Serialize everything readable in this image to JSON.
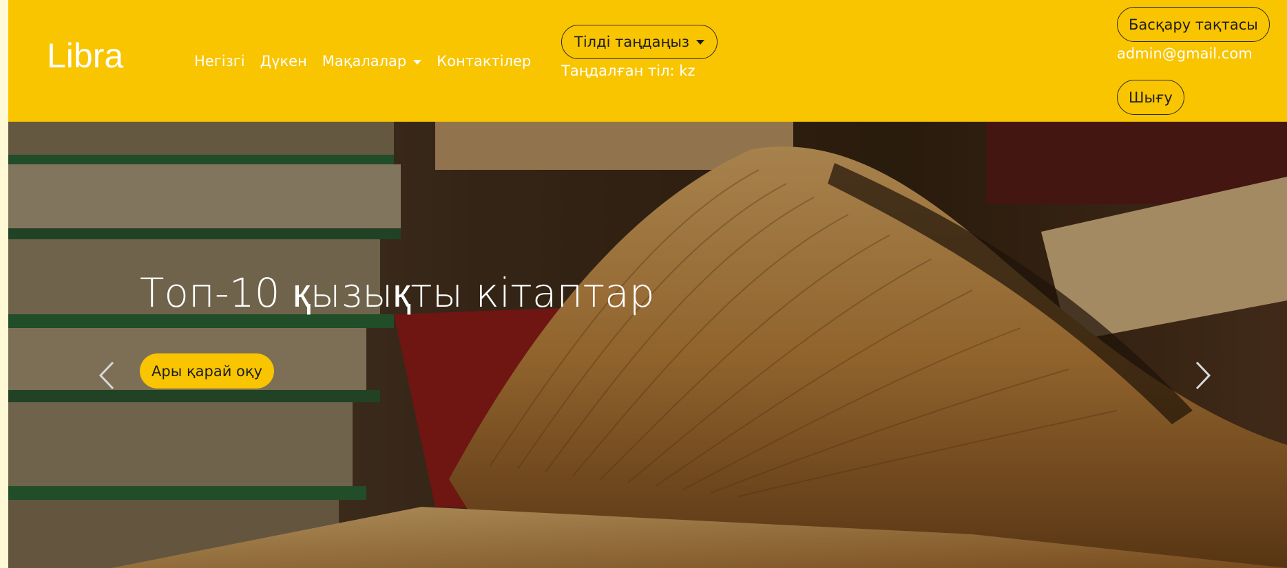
{
  "brand": "Libra",
  "nav": {
    "home": "Негізгі",
    "shop": "Дүкен",
    "articles": "Мақалалар",
    "contacts": "Контактілер"
  },
  "language": {
    "button_label": "Тілді таңдаңыз",
    "selected_label": "Таңдалған тіл: kz"
  },
  "user": {
    "dashboard_label": "Басқару тақтасы",
    "email": "admin@gmail.com",
    "logout_label": "Шығу"
  },
  "hero": {
    "title": "Топ-10 қызықты кітаптар",
    "button_label": "Ары қарай оқу"
  },
  "icons": {
    "prev": "chevron-left-icon",
    "next": "chevron-right-icon",
    "dropdown": "caret-down-icon"
  },
  "colors": {
    "accent": "#f9c400",
    "text_dark": "#1e1e1e",
    "text_light": "#ffffff",
    "page_bg": "#fff9d6"
  }
}
